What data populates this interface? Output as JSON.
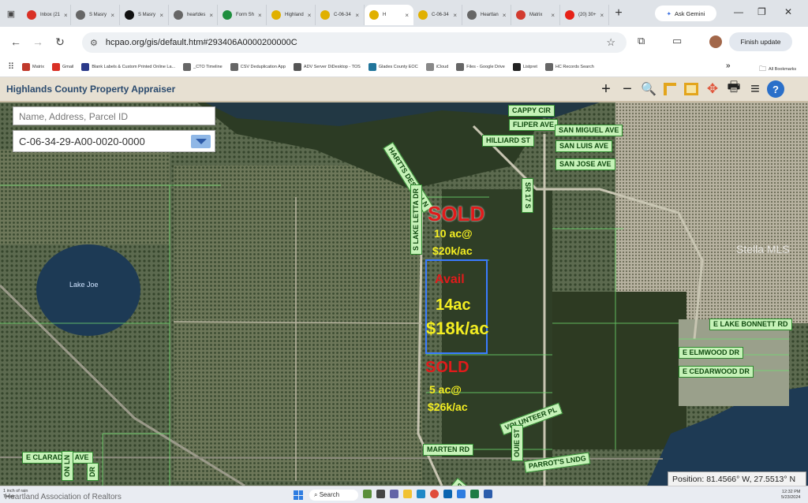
{
  "browser": {
    "tabs": [
      {
        "label": "Inbox (21",
        "icon": "gmail-icon",
        "color": "#d93025"
      },
      {
        "label": "S Masry",
        "icon": "globe-icon",
        "color": "#666666"
      },
      {
        "label": "S Masry",
        "icon": "d-logo-icon",
        "color": "#111111"
      },
      {
        "label": "heartdes",
        "icon": "globe-icon",
        "color": "#666666"
      },
      {
        "label": "Form Sh",
        "icon": "sheets-icon",
        "color": "#1e8e3e"
      },
      {
        "label": "Highland",
        "icon": "pawprint-icon",
        "color": "#e0b000"
      },
      {
        "label": "C-06-34",
        "icon": "pawprint-icon",
        "color": "#e0b000"
      },
      {
        "label": "H",
        "icon": "pawprint-icon",
        "color": "#e0b000",
        "active": true
      },
      {
        "label": "C-06-34",
        "icon": "pawprint-icon",
        "color": "#e0b000"
      },
      {
        "label": "Heartlan",
        "icon": "globe-icon",
        "color": "#666666"
      },
      {
        "label": "Matrix",
        "icon": "matrix-icon",
        "color": "#d23b2f"
      },
      {
        "label": "(20) 30+",
        "icon": "youtube-icon",
        "color": "#e62117"
      }
    ],
    "gemini_label": "Ask Gemini",
    "url": "hcpao.org/gis/default.htm#293406A0000200000C",
    "finish_update_label": "Finish update",
    "bookmarks": [
      {
        "label": "Matrix",
        "icon": "matrix-icon",
        "color": "#c0392b"
      },
      {
        "label": "Gmail",
        "icon": "gmail-icon",
        "color": "#d93025"
      },
      {
        "label": "Blank Labels & Custom Printed Online La...",
        "icon": "label-icon",
        "color": "#2b3a8a"
      },
      {
        "label": "_CTO Timeline",
        "icon": "globe-icon",
        "color": "#666666"
      },
      {
        "label": "CSV Deduplication App",
        "icon": "globe-icon",
        "color": "#666666"
      },
      {
        "label": "ADV Server DiDesktop - TOS",
        "icon": "server-icon",
        "color": "#555555"
      },
      {
        "label": "Glades County EOC",
        "icon": "wordpress-icon",
        "color": "#21759b"
      },
      {
        "label": "iCloud",
        "icon": "apple-icon",
        "color": "#888888"
      },
      {
        "label": "Files - Google Drive",
        "icon": "globe-icon",
        "color": "#666666"
      },
      {
        "label": "Listpret",
        "icon": "soccer-icon",
        "color": "#222222"
      },
      {
        "label": "HC Records Search",
        "icon": "globe-icon",
        "color": "#666666"
      }
    ],
    "all_bookmarks_label": "All Bookmarks"
  },
  "app": {
    "title": "Highlands County Property Appraiser",
    "search_placeholder": "Name, Address, Parcel ID",
    "parcel_id": "C-06-34-29-A00-0020-0000",
    "position_text": "Position: 81.4566° W, 27.5513° N"
  },
  "map": {
    "roads": [
      "CAPPY CIR",
      "FLIPER AVE",
      "SAN MIGUEL AVE",
      "HILLIARD ST",
      "SAN LUIS AVE",
      "SAN JOSE AVE",
      "SR 17 S",
      "HARTTS DESIRE LN",
      "S LAKE LETTA DR",
      "E LAKE BONNETT RD",
      "E ELMWOOD DR",
      "E CEDARWOOD DR",
      "VOLUNTEER PL",
      "MARTEN RD",
      "PARROT'S LNDG",
      "E CLARADGE AVE",
      "OUIE ST",
      "S LAKE",
      "ON LN",
      "DR"
    ],
    "lake_label": "Lake Joe",
    "annotations": {
      "sold_top": "SOLD",
      "top_parcel_line1": "10 ac@",
      "top_parcel_line2": "$20k/ac",
      "avail": "Avail",
      "avail_acres": "14ac",
      "avail_price": "$18k/ac",
      "sold_bottom": "SOLD",
      "bottom_parcel_line1": "5 ac@",
      "bottom_parcel_line2": "$26k/ac"
    },
    "watermark": "Stella MLS",
    "colors": {
      "sold": "#e01b1b",
      "price": "#f4ee22",
      "parcel_outline": "#3a7bff",
      "road_label_bg": "#c6f2b8"
    }
  },
  "taskbar": {
    "left_small": "1 inch of rain",
    "left_small2": "Today",
    "association": "Heartland Association of Realtors",
    "search_label": "Search",
    "time": "12:32 PM",
    "date": "5/23/2024"
  }
}
